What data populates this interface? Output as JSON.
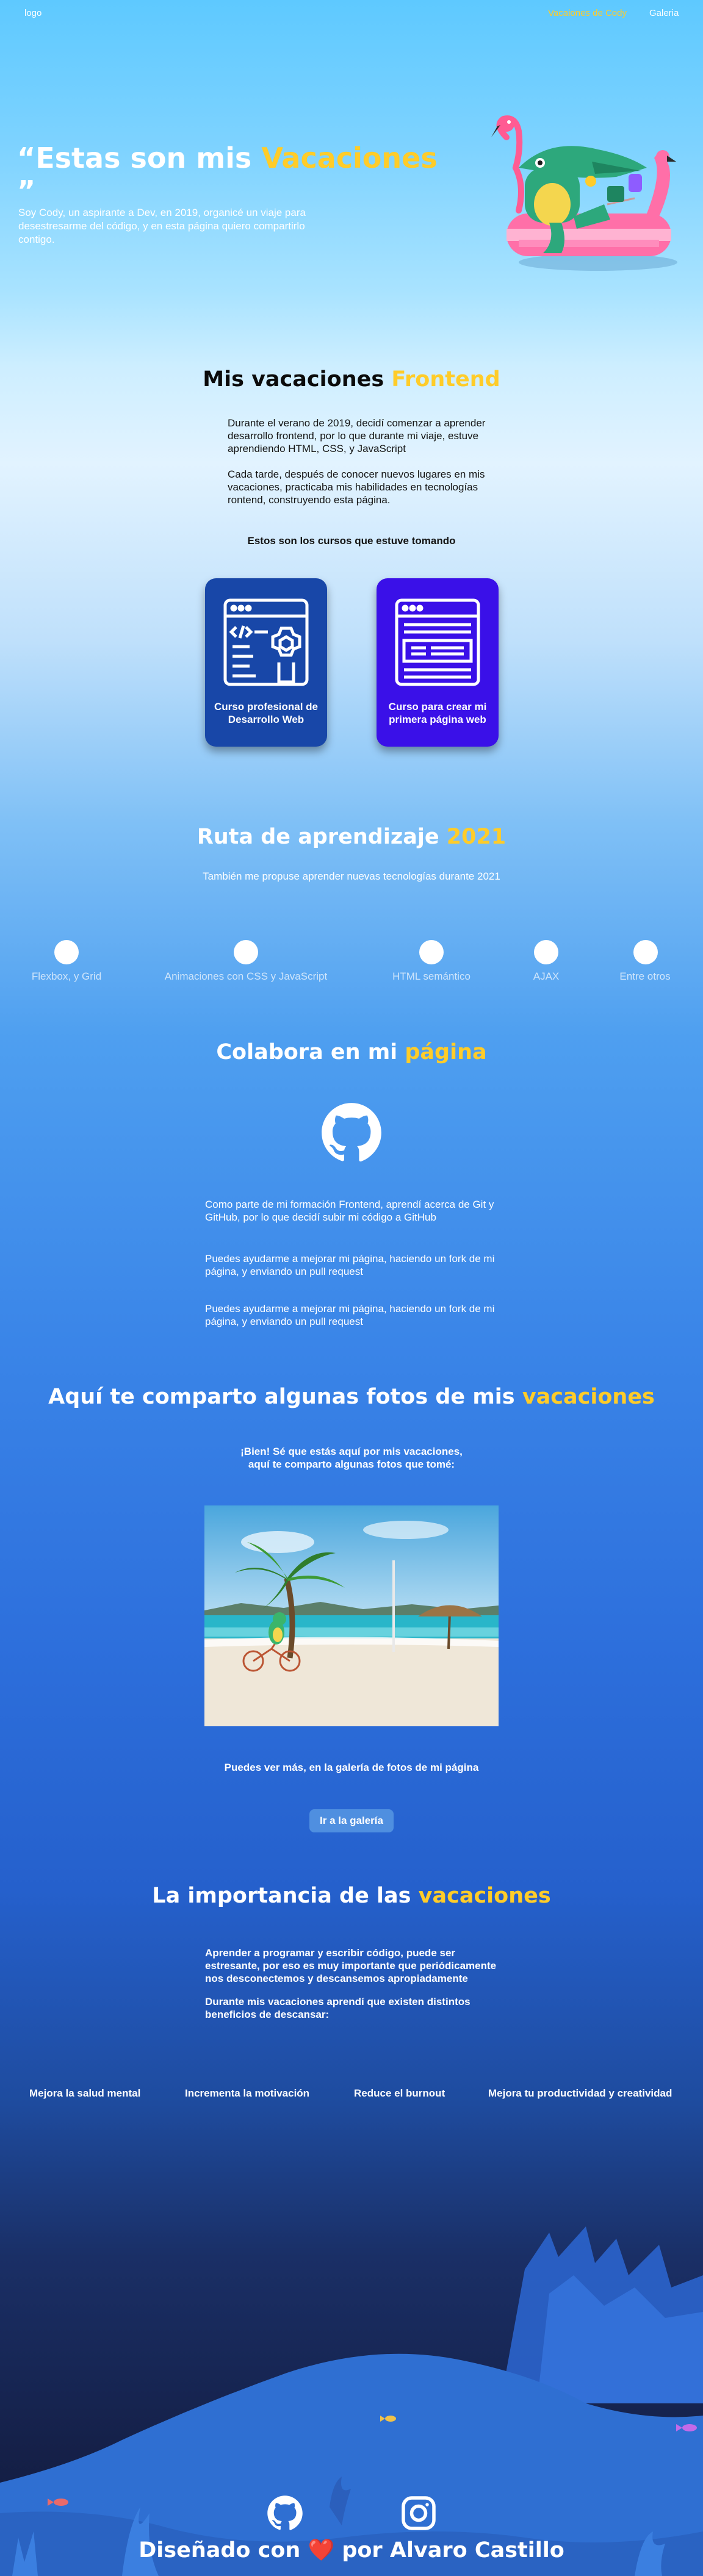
{
  "header": {
    "logo": "logo",
    "nav": [
      {
        "label": "Vacaiones de Cody"
      },
      {
        "label": "Galeria"
      }
    ]
  },
  "hero": {
    "title_part1": "“Estas son mis ",
    "title_highlight": "Vacaciones",
    "title_part2": " ”",
    "subtitle": "Soy Cody, un aspirante a Dev, en 2019, organicé un viaje para desestresarme del código, y en esta página quiero compartirlo contigo."
  },
  "frontend": {
    "title_part1": "Mis vacaciones ",
    "title_highlight": "Frontend",
    "paragraph1": "Durante el verano de 2019, decidí comenzar a aprender desarrollo frontend, por lo que durante mi viaje, estuve aprendiendo HTML, CSS, y JavaScript",
    "paragraph2": "Cada tarde, después de conocer nuevos lugares en mis vacaciones, practicaba mis habilidades en tecnologías rontend, construyendo esta página.",
    "courses_heading": "Estos son los cursos que estuve tomando",
    "courses": [
      {
        "label": "Curso profesional de Desarrollo Web",
        "color": "#1847a8",
        "icon": "code-gear-window-icon"
      },
      {
        "label": "Curso para crear mi primera página web",
        "color": "#3a10e8",
        "icon": "webpage-layout-icon"
      }
    ]
  },
  "learning": {
    "title_part1": "Ruta de aprendizaje ",
    "title_highlight": "2021",
    "subtitle": "También me propuse aprender nuevas tecnologías durante 2021",
    "topics": [
      "Flexbox, y Grid",
      "Animaciones con CSS y JavaScript",
      "HTML semántico",
      "AJAX",
      "Entre otros"
    ]
  },
  "collaborate": {
    "title_part1": "Colabora en mi ",
    "title_highlight": "página",
    "paragraphs": [
      "Como parte de mi formación Frontend, aprendí acerca de Git y GitHub, por lo que decidí subir mi código a GitHub",
      "Puedes ayudarme a mejorar mi página, haciendo un fork de mi página, y enviando un pull request",
      "Puedes ayudarme a mejorar mi página, haciendo un fork de mi página, y enviando un pull request"
    ]
  },
  "photos": {
    "title_part1": "Aquí te comparto algunas fotos de mis ",
    "title_highlight": "vacaciones",
    "subtitle": "¡Bien! Sé que estás aquí por mis vacaciones, aquí te comparto algunas fotos que tomé:",
    "more_text": "Puedes ver más, en la galería de fotos de mi página",
    "button": "Ir a la galería"
  },
  "importance": {
    "title_part1": "La importancia de las ",
    "title_highlight": "vacaciones",
    "paragraph1": "Aprender a programar y escribir código, puede ser estresante, por eso es muy importante que periódicamente nos desconectemos y descansemos apropiadamente",
    "paragraph2": "Durante mis vacaciones aprendí que existen distintos beneficios de descansar:",
    "benefits": [
      "Mejora la salud mental",
      "Incrementa la motivación",
      "Reduce el burnout",
      "Mejora tu productividad y creatividad"
    ]
  },
  "footer": {
    "text_part1": "Diseñado con ",
    "heart": "❤️",
    "text_part2": " por Alvaro Castillo",
    "icons": [
      "github-icon",
      "instagram-icon"
    ]
  },
  "colors": {
    "accent": "#ffcc29",
    "card1": "#1847a8",
    "card2": "#3a10e8"
  }
}
